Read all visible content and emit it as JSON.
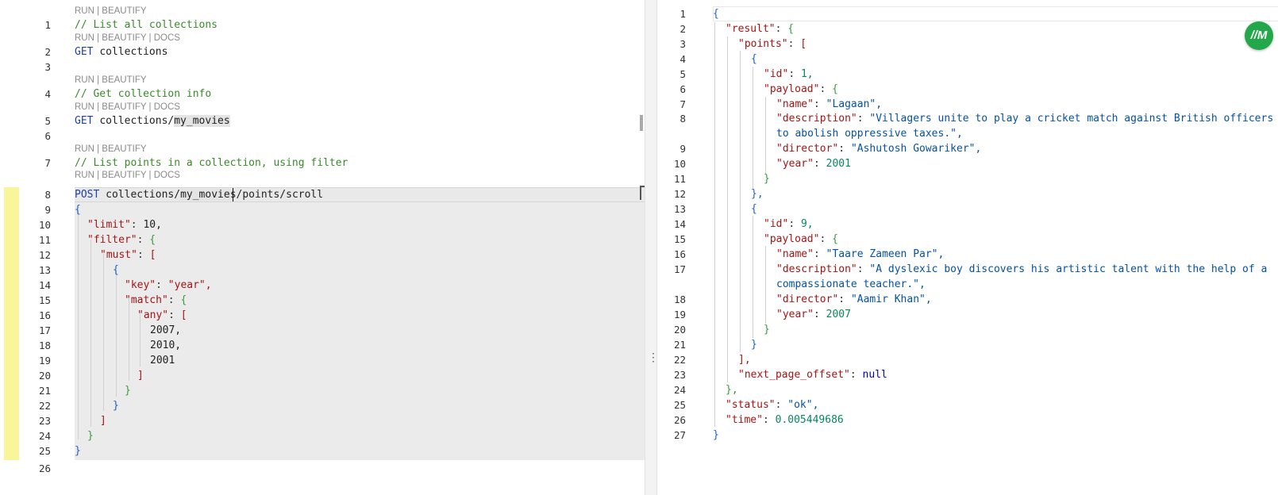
{
  "editor": {
    "code_lens": {
      "run_beautify": "RUN | BEAUTIFY",
      "run_beautify_docs": "RUN | BEAUTIFY | DOCS"
    },
    "lines": [
      {
        "n": "1",
        "comment": "// List all collections"
      },
      {
        "n": "2",
        "method": "GET",
        "path": "collections"
      },
      {
        "n": "3"
      },
      {
        "n": "4",
        "comment": "// Get collection info"
      },
      {
        "n": "5",
        "method": "GET",
        "path_prefix": "collections/",
        "path_hl": "my_movies"
      },
      {
        "n": "6"
      },
      {
        "n": "7",
        "comment": "// List points in a collection, using filter"
      },
      {
        "n": "8",
        "method": "POST",
        "path_prefix": "collections/",
        "path_hl": "my_movie",
        "path_hl2": "s",
        "path_suffix": "/points/scroll"
      },
      {
        "n": "9",
        "text": "{"
      },
      {
        "n": "10",
        "key": "\"limit\"",
        "value": "10,"
      },
      {
        "n": "11",
        "key": "\"filter\"",
        "value": "{"
      },
      {
        "n": "12",
        "key": "\"must\"",
        "value": "["
      },
      {
        "n": "13",
        "text": "{"
      },
      {
        "n": "14",
        "key": "\"key\"",
        "value": "\"year\","
      },
      {
        "n": "15",
        "key": "\"match\"",
        "value": "{"
      },
      {
        "n": "16",
        "key": "\"any\"",
        "value": "["
      },
      {
        "n": "17",
        "text": "2007,"
      },
      {
        "n": "18",
        "text": "2010,"
      },
      {
        "n": "19",
        "text": "2001"
      },
      {
        "n": "20",
        "text": "]"
      },
      {
        "n": "21",
        "text": "}"
      },
      {
        "n": "22",
        "text": "}"
      },
      {
        "n": "23",
        "text": "]"
      },
      {
        "n": "24",
        "text": "}"
      },
      {
        "n": "25",
        "text": "}"
      },
      {
        "n": "26"
      }
    ]
  },
  "output": {
    "lines": [
      {
        "n": "1",
        "text": "{"
      },
      {
        "n": "2",
        "key": "\"result\"",
        "value": "{"
      },
      {
        "n": "3",
        "key": "\"points\"",
        "value": "["
      },
      {
        "n": "4",
        "text": "{"
      },
      {
        "n": "5",
        "key": "\"id\"",
        "value": "1,"
      },
      {
        "n": "6",
        "key": "\"payload\"",
        "value": "{"
      },
      {
        "n": "7",
        "key": "\"name\"",
        "value": "\"Lagaan\","
      },
      {
        "n": "8",
        "key": "\"description\"",
        "value": "\"Villagers unite to play a cricket match against British officers",
        "cont": "to abolish oppressive taxes.\","
      },
      {
        "n": "9",
        "key": "\"director\"",
        "value": "\"Ashutosh Gowariker\","
      },
      {
        "n": "10",
        "key": "\"year\"",
        "value": "2001"
      },
      {
        "n": "11",
        "text": "}"
      },
      {
        "n": "12",
        "text": "},"
      },
      {
        "n": "13",
        "text": "{"
      },
      {
        "n": "14",
        "key": "\"id\"",
        "value": "9,"
      },
      {
        "n": "15",
        "key": "\"payload\"",
        "value": "{"
      },
      {
        "n": "16",
        "key": "\"name\"",
        "value": "\"Taare Zameen Par\","
      },
      {
        "n": "17",
        "key": "\"description\"",
        "value": "\"A dyslexic boy discovers his artistic talent with the help of a",
        "cont": "compassionate teacher.\","
      },
      {
        "n": "18",
        "key": "\"director\"",
        "value": "\"Aamir Khan\","
      },
      {
        "n": "19",
        "key": "\"year\"",
        "value": "2007"
      },
      {
        "n": "20",
        "text": "}"
      },
      {
        "n": "21",
        "text": "}"
      },
      {
        "n": "22",
        "text": "],"
      },
      {
        "n": "23",
        "key": "\"next_page_offset\"",
        "value": "null"
      },
      {
        "n": "24",
        "text": "},"
      },
      {
        "n": "25",
        "key": "\"status\"",
        "value": "\"ok\","
      },
      {
        "n": "26",
        "key": "\"time\"",
        "value": "0.005449686"
      },
      {
        "n": "27",
        "text": "}"
      }
    ]
  },
  "logo": {
    "text": "//M",
    "color": "#22a84a"
  }
}
